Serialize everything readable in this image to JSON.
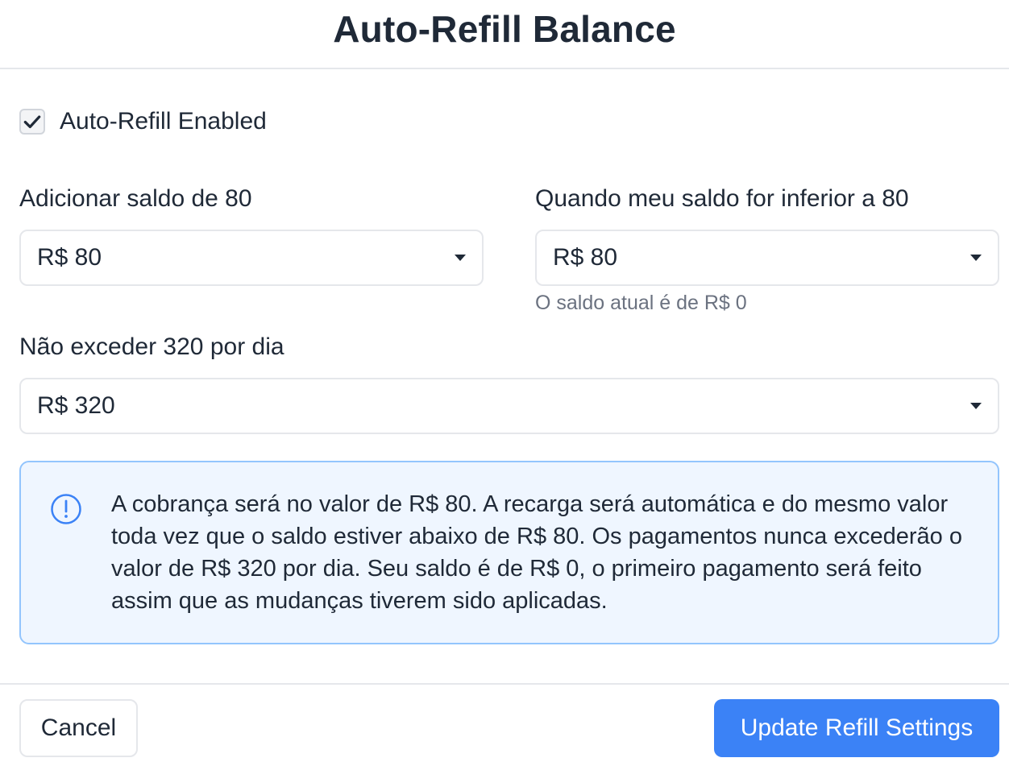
{
  "dialog": {
    "title": "Auto-Refill Balance"
  },
  "auto_refill": {
    "checkbox_label": "Auto-Refill Enabled",
    "enabled": true
  },
  "add_amount": {
    "label": "Adicionar saldo de 80",
    "value": "R$ 80"
  },
  "threshold": {
    "label": "Quando meu saldo for inferior a 80",
    "value": "R$ 80",
    "hint": "O saldo atual é de R$ 0"
  },
  "daily_limit": {
    "label": "Não exceder 320 por dia",
    "value": "R$ 320"
  },
  "info": {
    "icon": "info-circle-icon",
    "text": "A cobrança será no valor de R$ 80. A recarga será automática e do mesmo valor toda vez que o saldo estiver abaixo de R$ 80. Os pagamentos nunca excederão o valor de R$ 320 por dia. Seu saldo é de R$ 0, o primeiro pagamento será feito assim que as mudanças tiverem sido aplicadas."
  },
  "footer": {
    "cancel_label": "Cancel",
    "submit_label": "Update Refill Settings"
  },
  "colors": {
    "primary": "#3b82f6",
    "info_border": "#93c5fd",
    "info_background": "#eff6ff",
    "text": "#1f2937",
    "muted": "#6b7280"
  }
}
